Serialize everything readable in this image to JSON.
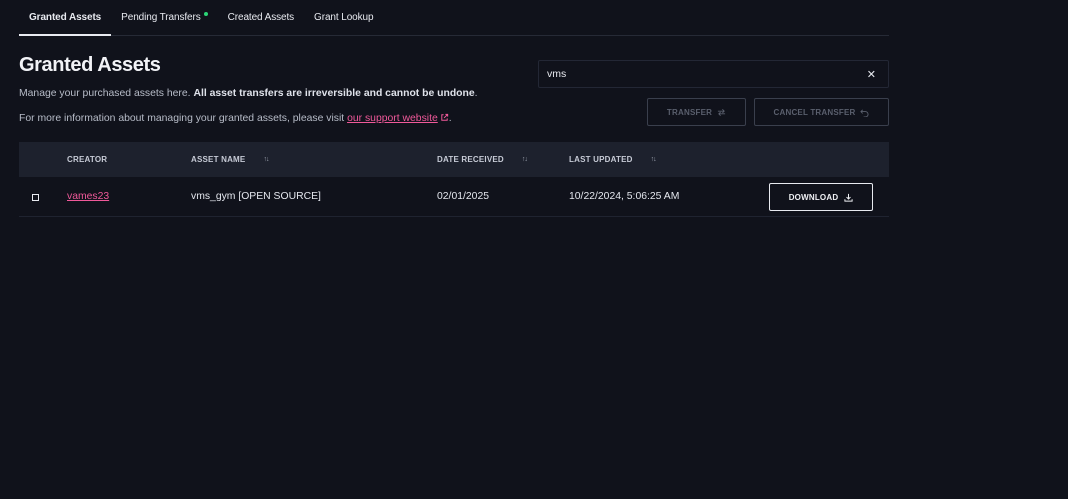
{
  "tabs": [
    {
      "label": "Granted Assets",
      "active": true
    },
    {
      "label": "Pending Transfers",
      "active": false,
      "has_dot": true
    },
    {
      "label": "Created Assets",
      "active": false
    },
    {
      "label": "Grant Lookup",
      "active": false
    }
  ],
  "header": {
    "title": "Granted Assets",
    "desc1_plain": "Manage your purchased assets here. ",
    "desc1_bold": "All asset transfers are irreversible and cannot be undone",
    "desc1_end": ".",
    "desc2_plain": "For more information about managing your granted assets, please visit ",
    "desc2_link": "our support website",
    "desc2_end": "."
  },
  "search": {
    "value": "vms",
    "clear_label": "✕"
  },
  "actions": {
    "transfer_label": "TRANSFER",
    "cancel_label": "CANCEL TRANSFER"
  },
  "table": {
    "columns": {
      "creator": "CREATOR",
      "asset_name": "ASSET NAME",
      "date_received": "DATE RECEIVED",
      "last_updated": "LAST UPDATED"
    },
    "rows": [
      {
        "creator": "vames23",
        "asset_name": "vms_gym [OPEN SOURCE]",
        "date_received": "02/01/2025",
        "last_updated": "10/22/2024, 5:06:25 AM",
        "download_label": "DOWNLOAD"
      }
    ]
  },
  "colors": {
    "background": "#10121b",
    "accent_link": "#f0599a",
    "status_dot": "#2bd576",
    "table_header": "#1d212d"
  }
}
